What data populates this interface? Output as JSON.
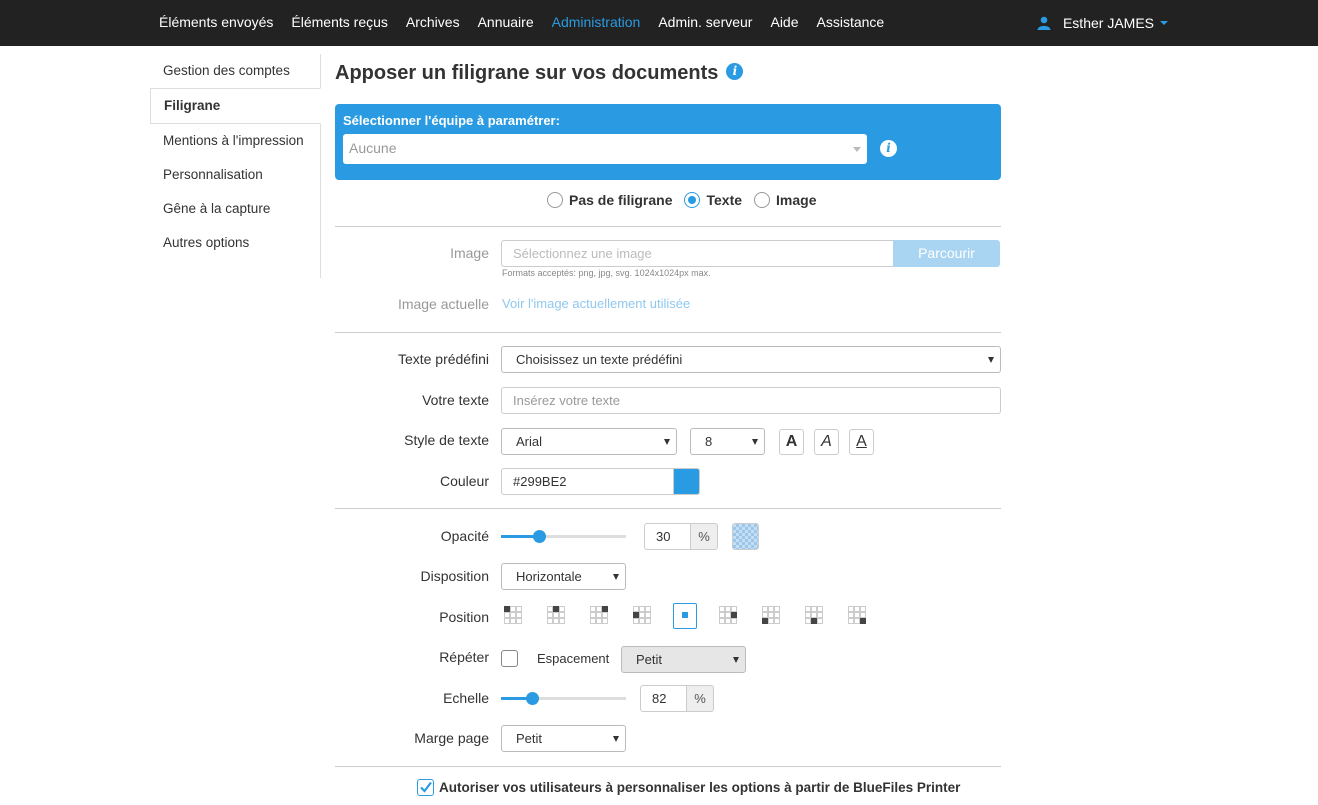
{
  "nav": {
    "items": [
      "Éléments envoyés",
      "Éléments reçus",
      "Archives",
      "Annuaire",
      "Administration",
      "Admin. serveur",
      "Aide",
      "Assistance"
    ],
    "active_index": 4,
    "user_name": "Esther JAMES"
  },
  "sidebar": {
    "items": [
      "Gestion des comptes",
      "Filigrane",
      "Mentions à l'impression",
      "Personnalisation",
      "Gêne à la capture",
      "Autres options"
    ],
    "active_index": 1
  },
  "page": {
    "title": "Apposer un filigrane sur vos documents",
    "team_label": "Sélectionner l'équipe à paramétrer:",
    "team_value": "Aucune"
  },
  "watermark_type": {
    "options": [
      "Pas de filigrane",
      "Texte",
      "Image"
    ],
    "selected": "Texte"
  },
  "image_section": {
    "image_label": "Image",
    "image_placeholder": "Sélectionnez une image",
    "browse_label": "Parcourir",
    "formats_hint": "Formats acceptés: png, jpg, svg. 1024x1024px max.",
    "current_label": "Image actuelle",
    "current_link": "Voir l'image actuellement utilisée"
  },
  "text_section": {
    "predefined_label": "Texte prédéfini",
    "predefined_value": "Choisissez un texte prédéfini",
    "your_text_label": "Votre texte",
    "your_text_placeholder": "Insérez votre texte",
    "style_label": "Style de texte",
    "font_value": "Arial",
    "size_value": "8",
    "style_buttons": [
      "A",
      "A",
      "A"
    ],
    "color_label": "Couleur",
    "color_value": "#299BE2"
  },
  "layout_section": {
    "opacity_label": "Opacité",
    "opacity_value": "30",
    "opacity_fraction": 0.3,
    "percent_sign": "%",
    "disposition_label": "Disposition",
    "disposition_value": "Horizontale",
    "position_label": "Position",
    "position_selected": 4,
    "repeat_label": "Répéter",
    "repeat_checked": false,
    "spacing_label": "Espacement",
    "spacing_value": "Petit",
    "scale_label": "Echelle",
    "scale_value": "82",
    "scale_fraction": 0.25,
    "margin_label": "Marge page",
    "margin_value": "Petit"
  },
  "footer": {
    "allow_label": "Autoriser vos utilisateurs à personnaliser les options à partir de BlueFiles Printer",
    "allow_checked": true
  },
  "colors": {
    "accent": "#2a9be2",
    "topbar": "#222222"
  }
}
